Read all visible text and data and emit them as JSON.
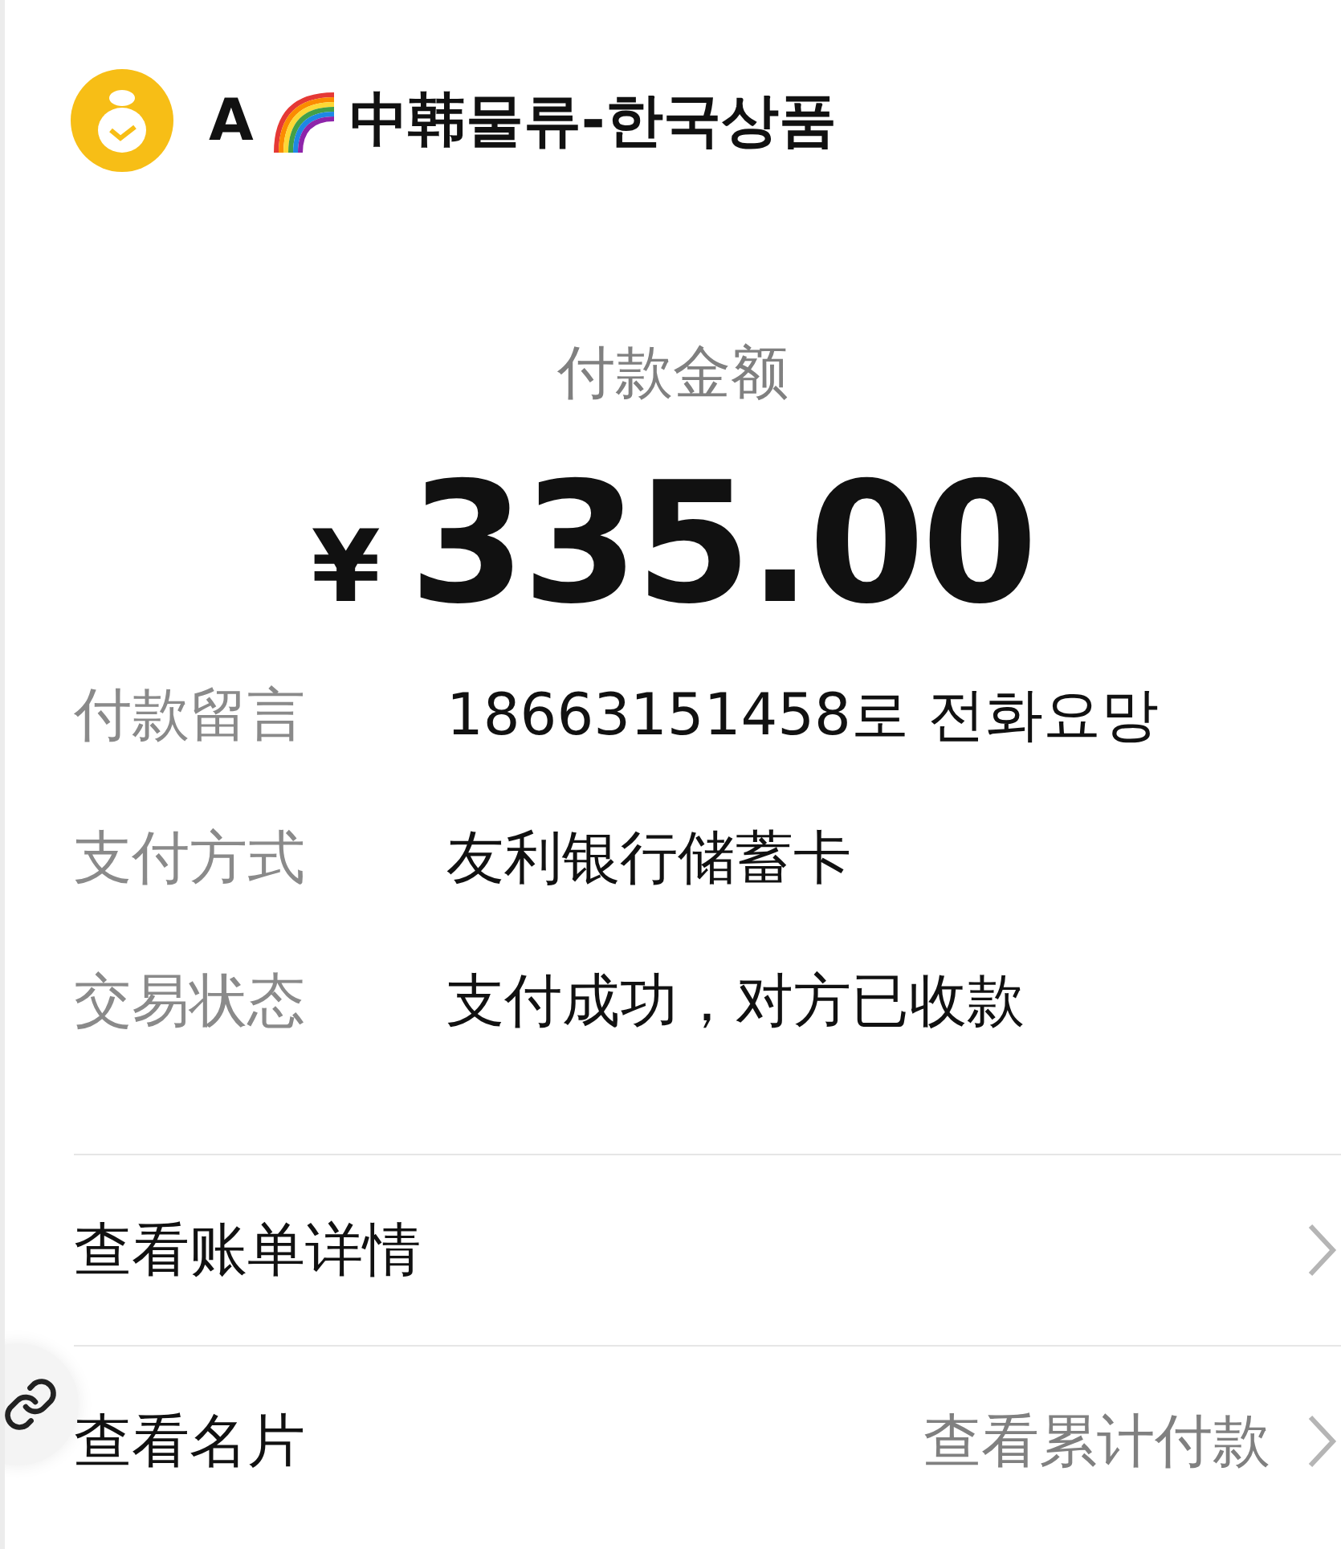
{
  "header": {
    "prefix": "A",
    "title": "中韩물류-한국상품"
  },
  "amount": {
    "label": "付款金额",
    "currency": "¥",
    "value": "335.00"
  },
  "details": [
    {
      "label": "付款留言",
      "value": "18663151458로 전화요망"
    },
    {
      "label": "支付方式",
      "value": "友利银行储蓄卡"
    },
    {
      "label": "交易状态",
      "value": "支付成功，对方已收款"
    }
  ],
  "links": [
    {
      "label": "查看账单详情"
    },
    {
      "label": "查看名片",
      "secondary": "查看累计付款"
    }
  ]
}
